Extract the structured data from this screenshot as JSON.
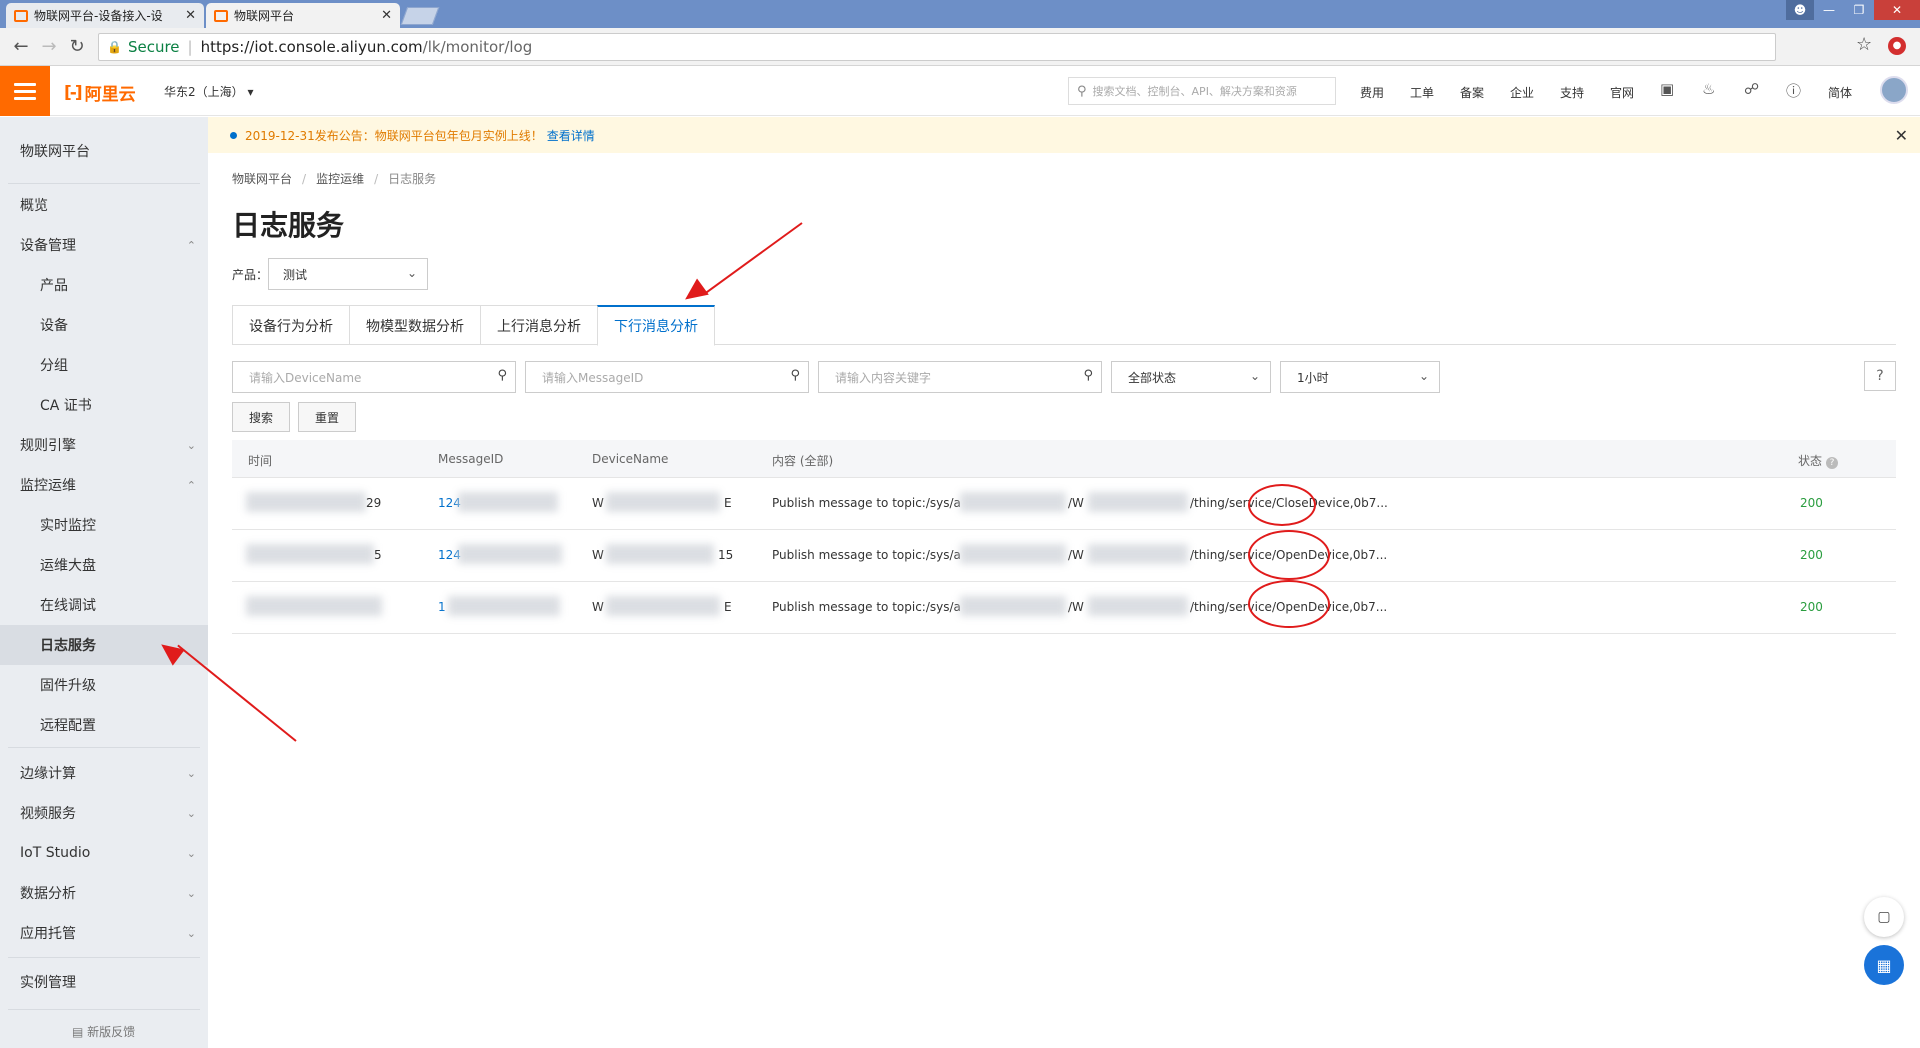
{
  "browser": {
    "tabs": [
      {
        "label": "物联网平台-设备接入-设"
      },
      {
        "label": "物联网平台"
      }
    ],
    "tab_close": "✕",
    "address": {
      "secure_label": "Secure",
      "url_host": "https://iot.console.aliyun.com",
      "url_path": "/lk/monitor/log"
    }
  },
  "header": {
    "brand": "阿里云",
    "region": "华东2（上海）",
    "search_placeholder": "搜索文档、控制台、API、解决方案和资源",
    "nav": [
      "费用",
      "工单",
      "备案",
      "企业",
      "支持",
      "官网"
    ],
    "lang": "简体"
  },
  "announcement": {
    "text": "2019-12-31发布公告：物联网平台包年包月实例上线！",
    "link": "查看详情"
  },
  "sidebar": {
    "title": "物联网平台",
    "items": [
      {
        "label": "概览",
        "level": 1
      },
      {
        "label": "设备管理",
        "level": 1,
        "chevron": "up"
      },
      {
        "label": "产品",
        "level": 2
      },
      {
        "label": "设备",
        "level": 2
      },
      {
        "label": "分组",
        "level": 2
      },
      {
        "label": "CA 证书",
        "level": 2
      },
      {
        "label": "规则引擎",
        "level": 1,
        "chevron": "down"
      },
      {
        "label": "监控运维",
        "level": 1,
        "chevron": "up"
      },
      {
        "label": "实时监控",
        "level": 2
      },
      {
        "label": "运维大盘",
        "level": 2
      },
      {
        "label": "在线调试",
        "level": 2
      },
      {
        "label": "日志服务",
        "level": 2,
        "active": true
      },
      {
        "label": "固件升级",
        "level": 2
      },
      {
        "label": "远程配置",
        "level": 2
      }
    ],
    "items_bottom": [
      {
        "label": "边缘计算"
      },
      {
        "label": "视频服务"
      },
      {
        "label": "IoT Studio"
      },
      {
        "label": "数据分析"
      },
      {
        "label": "应用托管"
      }
    ],
    "instance": "实例管理",
    "feedback": "新版反馈"
  },
  "breadcrumb": [
    "物联网平台",
    "监控运维",
    "日志服务"
  ],
  "page_title": "日志服务",
  "product": {
    "label": "产品：",
    "value": "测试"
  },
  "tabs": [
    {
      "label": "设备行为分析",
      "active": false
    },
    {
      "label": "物模型数据分析",
      "active": false
    },
    {
      "label": "上行消息分析",
      "active": false
    },
    {
      "label": "下行消息分析",
      "active": true
    }
  ],
  "filters": {
    "device_placeholder": "请输入DeviceName",
    "message_placeholder": "请输入MessageID",
    "content_placeholder": "请输入内容关键字",
    "status_value": "全部状态",
    "time_value": "1小时",
    "help": "?",
    "search_btn": "搜索",
    "reset_btn": "重置"
  },
  "table": {
    "headers": [
      "时间",
      "MessageID",
      "DeviceName",
      "内容 (全部)",
      "状态"
    ],
    "rows": [
      {
        "time_tail": "29",
        "mid_head": "124",
        "dev_head": "W",
        "dev_tail": "E",
        "content_head": "Publish message to topic:/sys/a",
        "content_mid": "/W",
        "content_tail": "/thing/service/CloseDevice,0b7...",
        "status": "200"
      },
      {
        "time_tail": "5",
        "mid_head": "124",
        "dev_head": "W",
        "dev_tail": "15",
        "content_head": "Publish message to topic:/sys/a",
        "content_mid": "/W",
        "content_tail": "/thing/service/OpenDevice,0b7...",
        "status": "200"
      },
      {
        "time_tail": "",
        "mid_head": "1",
        "dev_head": "W",
        "dev_tail": "E",
        "content_head": "Publish message to topic:/sys/a",
        "content_mid": "/W",
        "content_tail": "/thing/service/OpenDevice,0b7...",
        "status": "200"
      }
    ]
  },
  "colors": {
    "brand": "#ff6a00",
    "link": "#0070cc",
    "annotation": "#e01b1b",
    "status_ok": "#2a9d3f"
  }
}
